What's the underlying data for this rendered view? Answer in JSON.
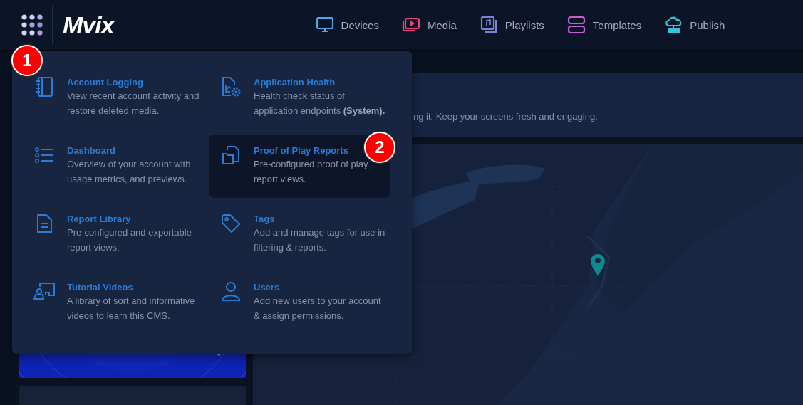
{
  "header": {
    "logo": "Mvix",
    "nav": [
      {
        "label": "Devices",
        "kind": "monitor",
        "color": "#4da6e8"
      },
      {
        "label": "Media",
        "kind": "media",
        "color": "#e8457a"
      },
      {
        "label": "Playlists",
        "kind": "playlist",
        "color": "#7c83d6"
      },
      {
        "label": "Templates",
        "kind": "template",
        "color": "#c45fcf"
      },
      {
        "label": "Publish",
        "kind": "publish",
        "color": "#3cc0d8"
      }
    ]
  },
  "banner": {
    "text": "ng it. Keep your screens fresh and engaging."
  },
  "apps_menu": {
    "items": [
      {
        "title": "Account Logging",
        "description": "View recent account activity and restore deleted media.",
        "kind": "notebook",
        "selected": false
      },
      {
        "title": "Application Health",
        "description": "Health check status of application endpoints **(System).**",
        "kind": "health",
        "selected": false
      },
      {
        "title": "Dashboard",
        "description": "Overview of your account with usage metrics, and previews.",
        "kind": "list",
        "selected": false
      },
      {
        "title": "Proof of Play Reports",
        "description": "Pre-configured proof of play report views.",
        "kind": "reports",
        "selected": true
      },
      {
        "title": "Report Library",
        "description": "Pre-configured and exportable report views.",
        "kind": "document",
        "selected": false
      },
      {
        "title": "Tags",
        "description": "Add and manage tags for use in filtering & reports.",
        "kind": "tag",
        "selected": false
      },
      {
        "title": "Tutorial Videos",
        "description": "A library of sort and informative videos to learn this CMS.",
        "kind": "tutorial",
        "selected": false
      },
      {
        "title": "Users",
        "description": "Add new users to your account & assign permissions.",
        "kind": "user",
        "selected": false
      }
    ]
  },
  "callouts": [
    "1",
    "2"
  ]
}
